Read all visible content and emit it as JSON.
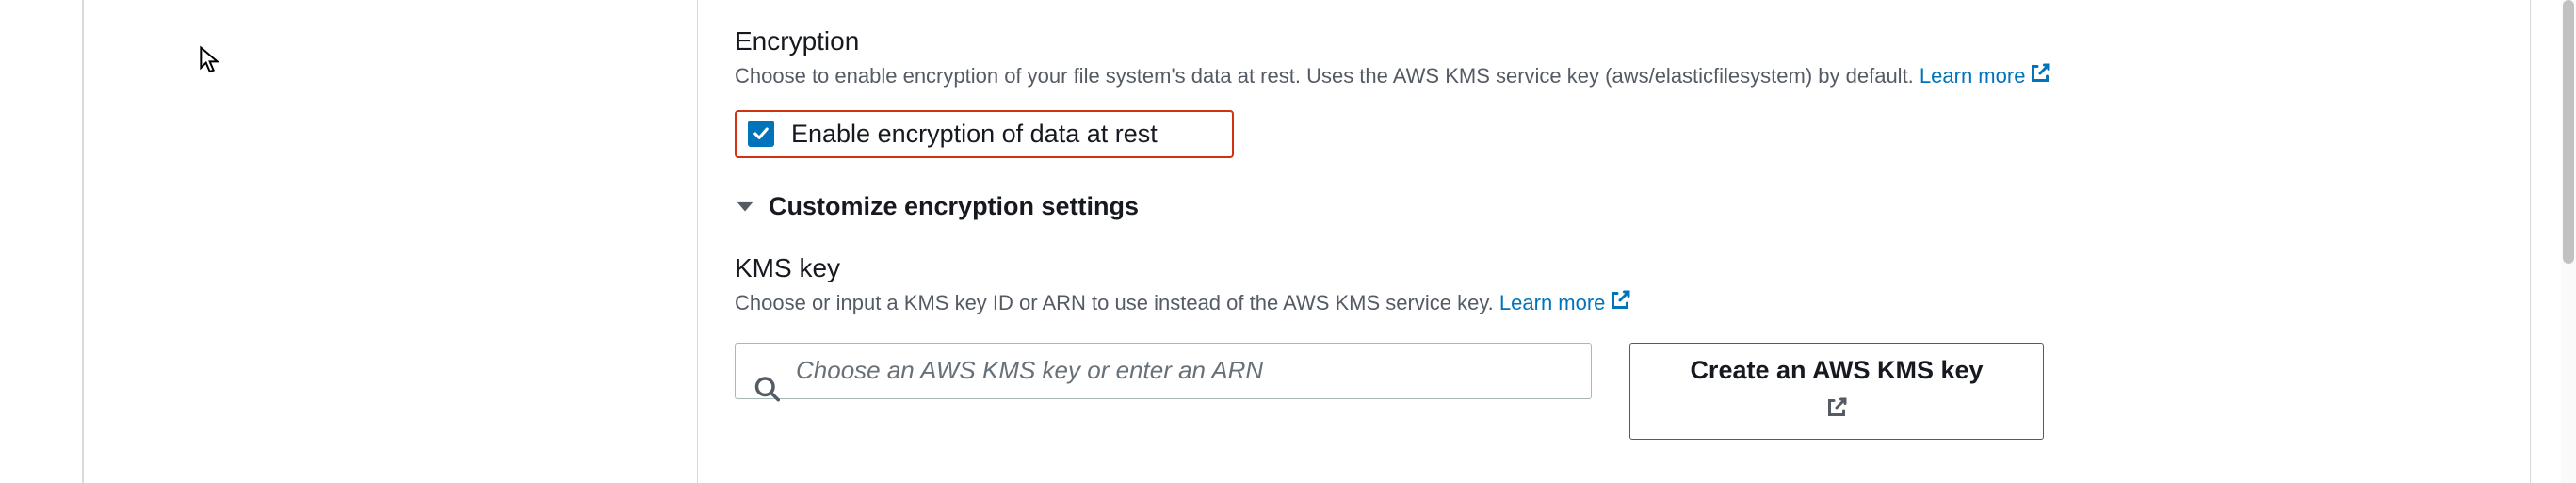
{
  "encryption": {
    "title": "Encryption",
    "description": "Choose to enable encryption of your file system's data at rest. Uses the AWS KMS service key (aws/elasticfilesystem) by default. ",
    "learn_more": "Learn more",
    "checkbox_label": "Enable encryption of data at rest",
    "checkbox_checked": true,
    "expander_label": "Customize encryption settings"
  },
  "kms": {
    "title": "KMS key",
    "description": "Choose or input a KMS key ID or ARN to use instead of the AWS KMS service key. ",
    "learn_more": "Learn more",
    "search_placeholder": "Choose an AWS KMS key or enter an ARN",
    "create_button_label": "Create an AWS KMS key"
  },
  "colors": {
    "link": "#0073bb",
    "border_highlight": "#d13212"
  }
}
